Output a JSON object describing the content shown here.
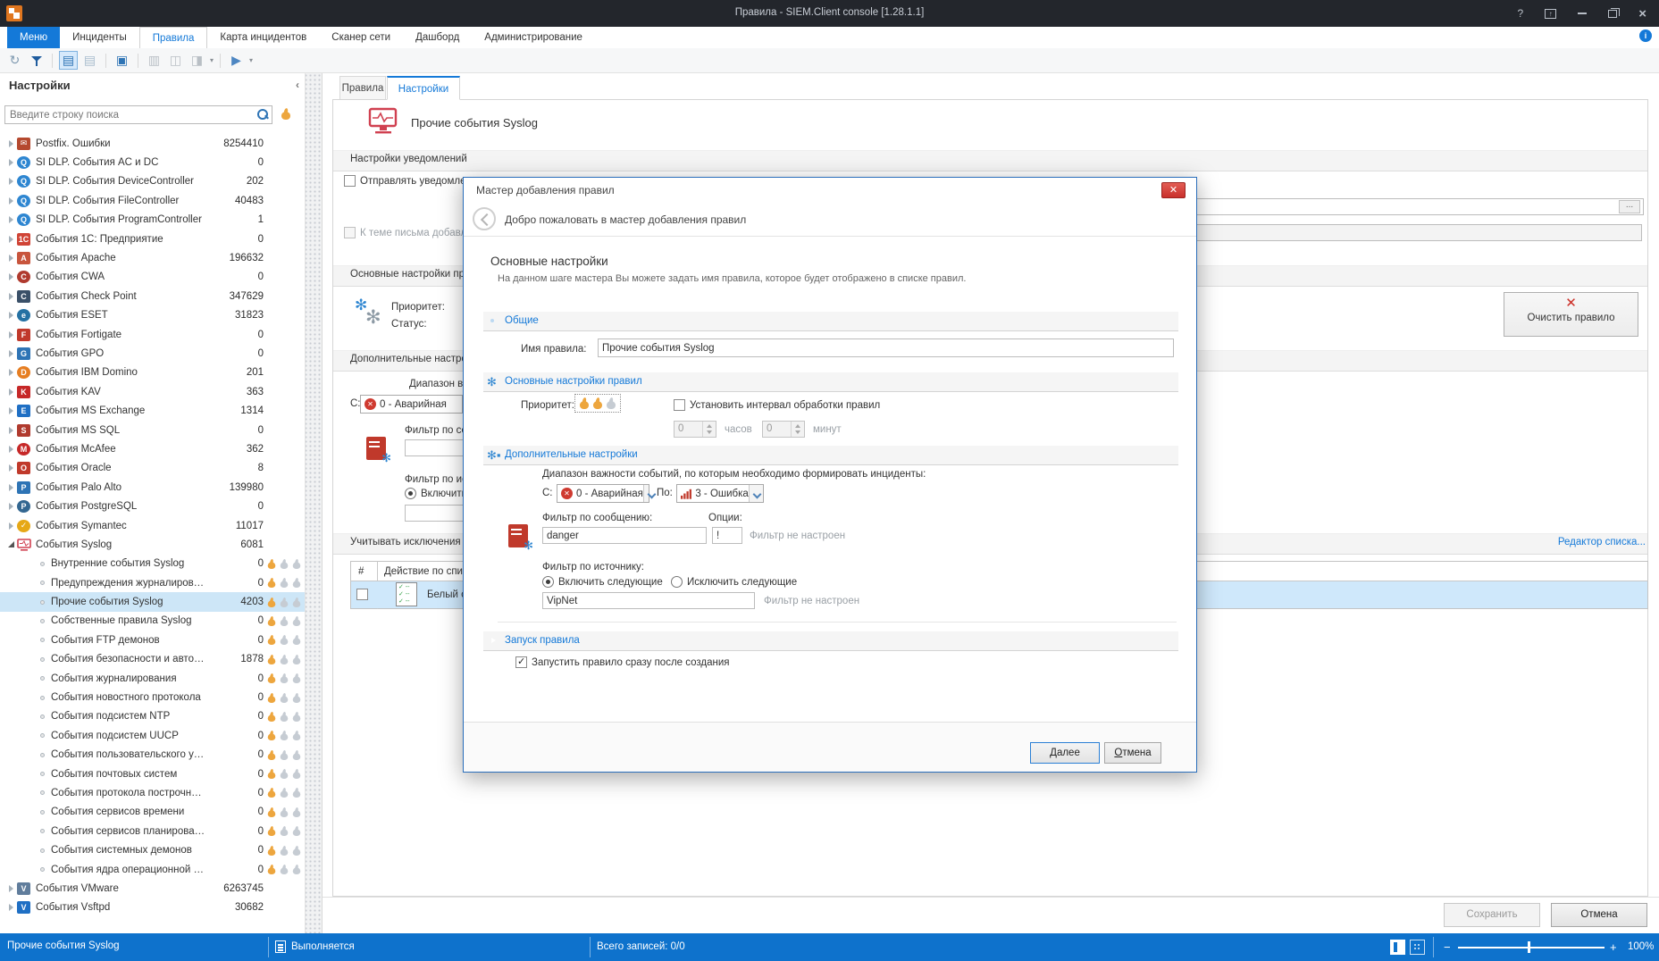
{
  "window": {
    "title": "Правила - SIEM.Client console [1.28.1.1]"
  },
  "menu": {
    "tabs": [
      {
        "label": "Меню",
        "style": "menu"
      },
      {
        "label": "Инциденты",
        "style": "normal"
      },
      {
        "label": "Правила",
        "style": "selected"
      },
      {
        "label": "Карта инцидентов",
        "style": "normal"
      },
      {
        "label": "Сканер сети",
        "style": "normal"
      },
      {
        "label": "Дашборд",
        "style": "normal"
      },
      {
        "label": "Администрирование",
        "style": "normal"
      }
    ]
  },
  "toolbar": {
    "items": [
      {
        "name": "refresh-icon",
        "type": "glyph",
        "g": "↻",
        "c": "#7e99b0"
      },
      {
        "name": "filter-icon",
        "type": "funnel"
      },
      {
        "type": "sep"
      },
      {
        "name": "rule-list-icon",
        "type": "glyph",
        "g": "▤",
        "c": "#2e74b5",
        "active": true
      },
      {
        "name": "rule-list-alt-icon",
        "type": "glyph",
        "g": "▤",
        "c": "#a8bccd"
      },
      {
        "type": "sep"
      },
      {
        "name": "card-view-icon",
        "type": "glyph",
        "g": "▣",
        "c": "#2e74b5"
      },
      {
        "type": "sep"
      },
      {
        "name": "print-icon",
        "type": "glyph",
        "g": "▥",
        "c": "#b9bfc5"
      },
      {
        "name": "print-preview-icon",
        "type": "glyph",
        "g": "◫",
        "c": "#b9bfc5"
      },
      {
        "name": "export-icon",
        "type": "glyph",
        "g": "◨",
        "c": "#b9bfc5",
        "dd": true
      },
      {
        "type": "sep"
      },
      {
        "name": "run-rule-icon",
        "type": "glyph",
        "g": "▶",
        "c": "#4d86c2",
        "dd": true
      }
    ]
  },
  "sidebar": {
    "title": "Настройки",
    "collapse_glyph": "‹",
    "search_placeholder": "Введите строку поиска",
    "items": [
      {
        "label": "Postfix. Ошибки",
        "count": "8254410",
        "icon": {
          "g": "✉",
          "bg": "#b5492f"
        }
      },
      {
        "label": "SI DLP. События AC и DC",
        "count": "0",
        "icon": {
          "g": "Q",
          "bg": "#2e86d1",
          "round": true
        }
      },
      {
        "label": "SI DLP. События DeviceController",
        "count": "202",
        "icon": {
          "g": "Q",
          "bg": "#2e86d1",
          "round": true
        }
      },
      {
        "label": "SI DLP. События FileController",
        "count": "40483",
        "icon": {
          "g": "Q",
          "bg": "#2e86d1",
          "round": true
        }
      },
      {
        "label": "SI DLP. События ProgramController",
        "count": "1",
        "icon": {
          "g": "Q",
          "bg": "#2e86d1",
          "round": true
        }
      },
      {
        "label": "События 1С: Предприятие",
        "count": "0",
        "icon": {
          "g": "1С",
          "bg": "#d04436"
        }
      },
      {
        "label": "События Apache",
        "count": "196632",
        "icon": {
          "g": "A",
          "bg": "#c8553d"
        }
      },
      {
        "label": "События CWA",
        "count": "0",
        "icon": {
          "g": "C",
          "bg": "#b03a2e",
          "round": true
        }
      },
      {
        "label": "События Check Point",
        "count": "347629",
        "icon": {
          "g": "C",
          "bg": "#3a5068"
        }
      },
      {
        "label": "События ESET",
        "count": "31823",
        "icon": {
          "g": "e",
          "bg": "#2471a3",
          "round": true
        }
      },
      {
        "label": "События Fortigate",
        "count": "0",
        "icon": {
          "g": "F",
          "bg": "#c0392b"
        }
      },
      {
        "label": "События GPO",
        "count": "0",
        "icon": {
          "g": "G",
          "bg": "#2e74b5"
        }
      },
      {
        "label": "События IBM Domino",
        "count": "201",
        "icon": {
          "g": "D",
          "bg": "#e67e22",
          "round": true
        }
      },
      {
        "label": "События KAV",
        "count": "363",
        "icon": {
          "g": "K",
          "bg": "#c62828"
        }
      },
      {
        "label": "События MS Exchange",
        "count": "1314",
        "icon": {
          "g": "E",
          "bg": "#1f6fc4"
        }
      },
      {
        "label": "События MS SQL",
        "count": "0",
        "icon": {
          "g": "S",
          "bg": "#b03a2e"
        }
      },
      {
        "label": "События McAfee",
        "count": "362",
        "icon": {
          "g": "M",
          "bg": "#c62828",
          "round": true
        }
      },
      {
        "label": "События Oracle",
        "count": "8",
        "icon": {
          "g": "O",
          "bg": "#c0392b"
        }
      },
      {
        "label": "События Palo Alto",
        "count": "139980",
        "icon": {
          "g": "P",
          "bg": "#2e74b5"
        }
      },
      {
        "label": "События PostgreSQL",
        "count": "0",
        "icon": {
          "g": "P",
          "bg": "#336791",
          "round": true
        }
      },
      {
        "label": "События Symantec",
        "count": "11017",
        "icon": {
          "g": "✓",
          "bg": "#e6a817",
          "round": true
        }
      },
      {
        "label": "События Syslog",
        "count": "6081",
        "icon": {
          "monitor": true
        },
        "expanded": true,
        "children": [
          {
            "label": "Внутренние события Syslog",
            "count": "0"
          },
          {
            "label": "Предупреждения журналирования",
            "count": "0"
          },
          {
            "label": "Прочие события Syslog",
            "count": "4203",
            "selected": true
          },
          {
            "label": "Собственные правила Syslog",
            "count": "0"
          },
          {
            "label": "События FTP демонов",
            "count": "0"
          },
          {
            "label": "События безопасности и авторизации",
            "count": "1878"
          },
          {
            "label": "События журналирования",
            "count": "0"
          },
          {
            "label": "События новостного протокола",
            "count": "0"
          },
          {
            "label": "События подсистем NTP",
            "count": "0"
          },
          {
            "label": "События подсистем UUCP",
            "count": "0"
          },
          {
            "label": "События пользовательского уровня",
            "count": "0"
          },
          {
            "label": "События почтовых систем",
            "count": "0"
          },
          {
            "label": "События протокола построчной печати",
            "count": "0"
          },
          {
            "label": "События сервисов времени",
            "count": "0"
          },
          {
            "label": "События сервисов планирования",
            "count": "0"
          },
          {
            "label": "События системных демонов",
            "count": "0"
          },
          {
            "label": "События ядра операционной системы",
            "count": "0"
          }
        ]
      },
      {
        "label": "События VMware",
        "count": "6263745",
        "icon": {
          "g": "V",
          "bg": "#607d9c"
        }
      },
      {
        "label": "События Vsftpd",
        "count": "30682",
        "icon": {
          "g": "V",
          "bg": "#1f6fc4"
        }
      }
    ]
  },
  "main": {
    "tab_rules": "Правила",
    "tab_settings": "Настройки",
    "rule_title": "Прочие события Syslog",
    "notif_band": "Настройки уведомлений",
    "send_cb": "Отправлять уведомления",
    "subject_cb": "К теме письма добавлять",
    "ellipsis_btn": "...",
    "rules_band": "Основные настройки правил",
    "priority_label": "Приоритет:",
    "status_label": "Статус:",
    "clear_button": "Очистить правило",
    "additional_band": "Дополнительные настройки",
    "range_label": "Диапазон важности событий, по которым необходимо формировать инциденты:",
    "from_label": "С:",
    "from_value": "0 - Аварийная",
    "msg_filter_label": "Фильтр по сообщению:",
    "src_filter_label": "Фильтр по источнику:",
    "include_radio": "Включить следующие",
    "exceptions_band": "Учитывать исключения",
    "list_editor_link": "Редактор списка...",
    "table": {
      "num": "#",
      "action": "Действие по списку",
      "row": "Белый список"
    },
    "save_button": "Сохранить",
    "cancel_button": "Отмена"
  },
  "dialog": {
    "title": "Мастер добавления правил",
    "close_glyph": "✕",
    "welcome": "Добро пожаловать в мастер добавления правил",
    "step_title": "Основные настройки",
    "step_desc": "На данном шаге мастера Вы можете задать имя правила, которое будет отображено в списке правил.",
    "general_band": "Общие",
    "name_label": "Имя правила:",
    "name_value": "Прочие события Syslog",
    "main_band": "Основные настройки правил",
    "priority_label": "Приоритет:",
    "interval_cb": "Установить интервал обработки правил",
    "hours_value": "0",
    "hours_label": "часов",
    "minutes_value": "0",
    "minutes_label": "минут",
    "additional_band": "Дополнительные настройки",
    "range_label": "Диапазон важности событий, по которым необходимо формировать инциденты:",
    "from_label": "С:",
    "from_value": "0 - Аварийная",
    "to_label": "По:",
    "to_value": "3 - Ошибка",
    "msg_label": "Фильтр по сообщению:",
    "msg_value": "danger",
    "opts_label": "Опции:",
    "opts_value": "!",
    "msg_not_configured": "Фильтр не настроен",
    "src_label": "Фильтр по источнику:",
    "include_radio": "Включить следующие",
    "exclude_radio": "Исключить следующие",
    "src_value": "VipNet",
    "src_not_configured": "Фильтр не настроен",
    "run_band": "Запуск правила",
    "run_cb": "Запустить правило сразу после создания",
    "next_button": "Далее",
    "cancel_button": "Отмена"
  },
  "statusbar": {
    "selected_rule": "Прочие события Syslog",
    "running": "Выполняется",
    "total": "Всего записей: 0/0",
    "zoom_minus": "−",
    "zoom_plus": "+",
    "zoom_level": "100%"
  },
  "colors": {
    "accent": "#1479d8",
    "statusbar": "#0e72cc",
    "selection": "#cde6f7",
    "flame": "#eda63e",
    "danger": "#cf3a30"
  }
}
